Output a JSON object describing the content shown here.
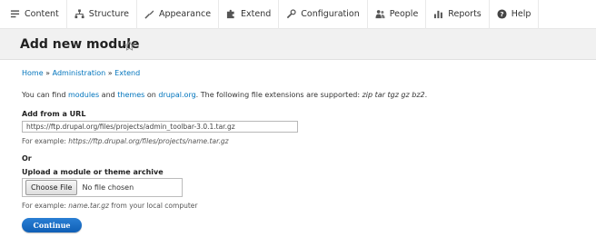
{
  "toolbar": {
    "items": [
      {
        "label": "Content",
        "icon": "content-icon"
      },
      {
        "label": "Structure",
        "icon": "structure-icon"
      },
      {
        "label": "Appearance",
        "icon": "appearance-icon"
      },
      {
        "label": "Extend",
        "icon": "extend-icon"
      },
      {
        "label": "Configuration",
        "icon": "configuration-icon"
      },
      {
        "label": "People",
        "icon": "people-icon"
      },
      {
        "label": "Reports",
        "icon": "reports-icon"
      },
      {
        "label": "Help",
        "icon": "help-icon"
      }
    ]
  },
  "header": {
    "title": "Add new module",
    "star_icon": "star-outline-icon"
  },
  "breadcrumb": {
    "items": [
      "Home",
      "Administration",
      "Extend"
    ],
    "separator": "»"
  },
  "intro": {
    "prefix": "You can find ",
    "link_modules": "modules",
    "and": " and ",
    "link_themes": "themes",
    "on": " on ",
    "link_site": "drupal.org",
    "suffix": ". The following file extensions are supported: ",
    "extensions": "zip tar tgz gz bz2",
    "end": "."
  },
  "url_field": {
    "label": "Add from a URL",
    "value": "https://ftp.drupal.org/files/projects/admin_toolbar-3.0.1.tar.gz",
    "description_prefix": "For example: ",
    "description_example": "https://ftp.drupal.org/files/projects/name.tar.gz"
  },
  "or_label": "Or",
  "upload_field": {
    "label": "Upload a module or theme archive",
    "button_label": "Choose File",
    "status": "No file chosen",
    "description_prefix": "For example: ",
    "description_example": "name.tar.gz",
    "description_suffix": " from your local computer"
  },
  "continue_button": "Continue",
  "colors": {
    "link": "#0074bd",
    "header_bg": "#f1f1f1",
    "primary_button": "#1a6fc8"
  }
}
